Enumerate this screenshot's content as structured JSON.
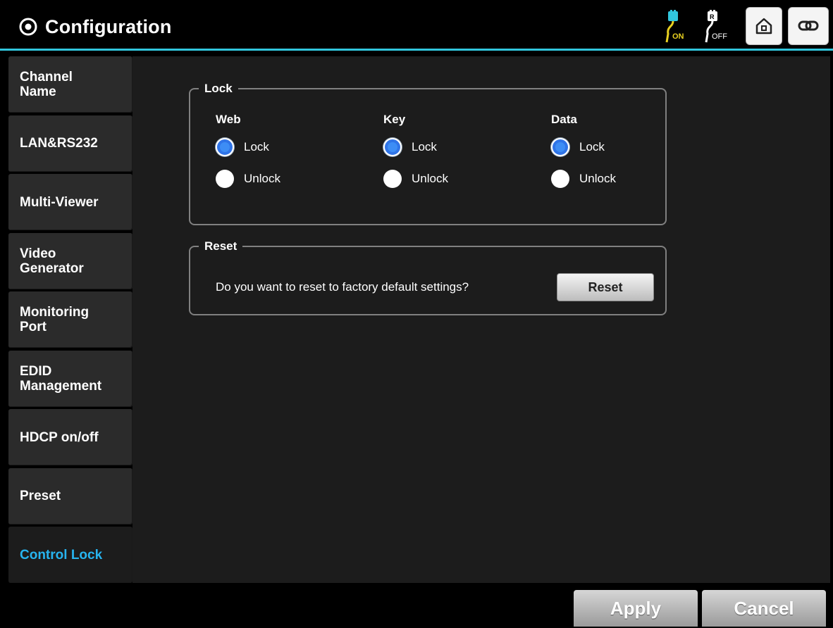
{
  "header": {
    "title": "Configuration",
    "power_on_label": "ON",
    "power_off_label": "OFF",
    "icons": [
      "gear-icon",
      "power-on-icon",
      "power-off-icon",
      "home-icon",
      "link-icon"
    ],
    "accent_color": "#31c6dd"
  },
  "sidebar": {
    "items": [
      {
        "label": "Channel\nName"
      },
      {
        "label": "LAN&RS232"
      },
      {
        "label": "Multi-Viewer"
      },
      {
        "label": "Video\nGenerator"
      },
      {
        "label": "Monitoring\nPort"
      },
      {
        "label": "EDID\nManagement"
      },
      {
        "label": "HDCP on/off"
      },
      {
        "label": "Preset"
      },
      {
        "label": "Control Lock"
      }
    ],
    "active": "Control Lock",
    "active_color": "#27b4ef"
  },
  "lock": {
    "legend": "Lock",
    "columns": [
      {
        "title": "Web",
        "options": [
          "Lock",
          "Unlock"
        ],
        "selected": "Lock"
      },
      {
        "title": "Key",
        "options": [
          "Lock",
          "Unlock"
        ],
        "selected": "Lock"
      },
      {
        "title": "Data",
        "options": [
          "Lock",
          "Unlock"
        ],
        "selected": "Lock"
      }
    ]
  },
  "reset": {
    "legend": "Reset",
    "question": "Do you want to reset to factory default settings?",
    "button_label": "Reset"
  },
  "footer": {
    "apply_label": "Apply",
    "cancel_label": "Cancel"
  }
}
